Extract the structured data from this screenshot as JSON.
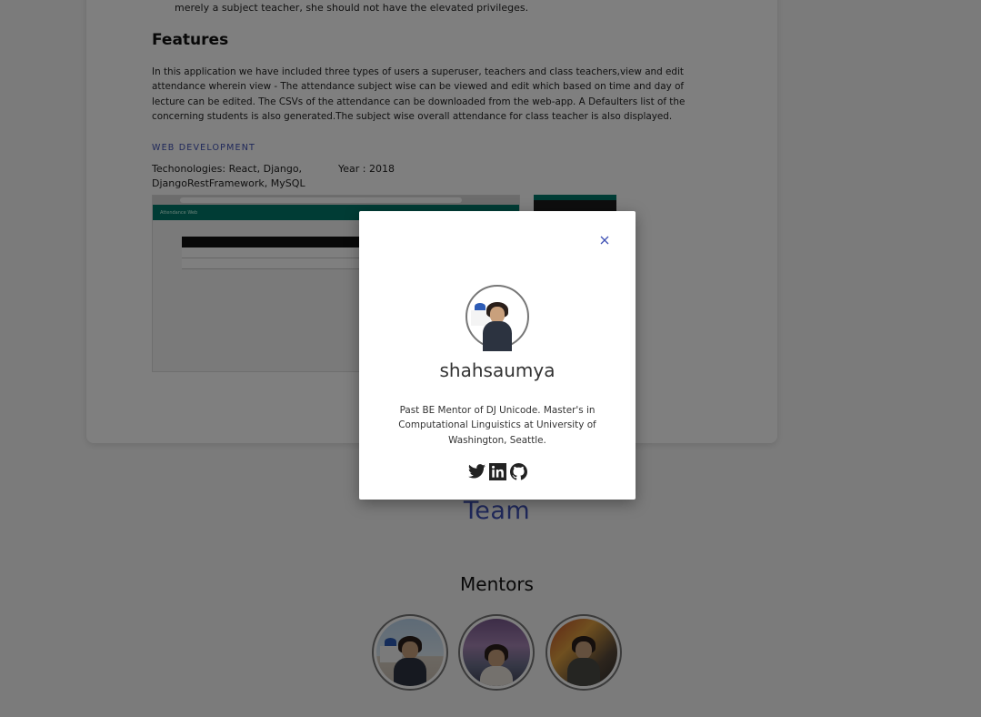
{
  "project": {
    "previous_text": "merely a subject teacher, she should not have the elevated privileges.",
    "features_heading": "Features",
    "features_body": "In this application we have included three types of users a superuser, teachers and class teachers,view and edit attendance wherein view - The attendance subject wise can be viewed and edit which based on time and day of lecture can be edited. The CSVs of the attendance can be downloaded from the web-app. A Defaulters list of the concerning students is also generated.The subject wise overall attendance for class teacher is also displayed.",
    "category": "WEB DEVELOPMENT",
    "technologies": "Techonologies: React, Django, DjangoRestFramework, MySQL",
    "year": "Year : 2018",
    "screenshot_app_title": "Attendance Web"
  },
  "team": {
    "heading": "Team",
    "mentors_heading": "Mentors",
    "mentors": [
      {
        "avatar": "mentor-photo-1"
      },
      {
        "avatar": "mentor-photo-2"
      },
      {
        "avatar": "mentor-photo-3"
      }
    ]
  },
  "modal": {
    "name": "shahsaumya",
    "bio": "Past BE Mentor of DJ Unicode. Master's in Computational Linguistics at University of Washington, Seattle.",
    "close_icon": "close-icon",
    "socials": [
      "twitter-icon",
      "linkedin-icon",
      "github-icon"
    ]
  },
  "colors": {
    "accent": "#3f51b5",
    "overlay": "rgba(0,0,0,0.5)",
    "app_bar": "#00796b"
  }
}
